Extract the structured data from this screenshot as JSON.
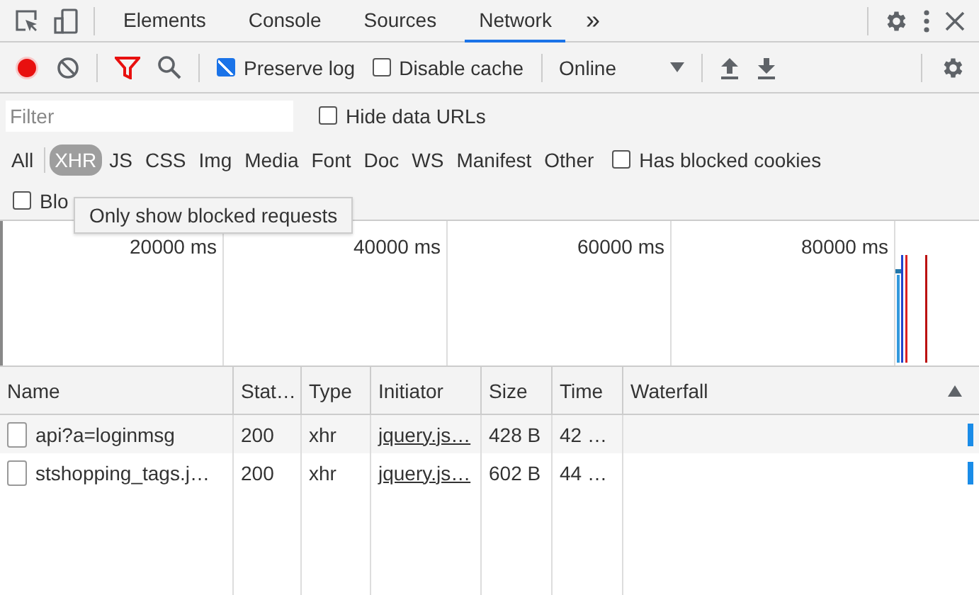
{
  "tabs": [
    {
      "label": "Elements",
      "selected": false
    },
    {
      "label": "Console",
      "selected": false
    },
    {
      "label": "Sources",
      "selected": false
    },
    {
      "label": "Network",
      "selected": true
    }
  ],
  "more_tabs": "»",
  "toolbar": {
    "recording": true,
    "preserve_log": {
      "label": "Preserve log",
      "checked": true
    },
    "disable_cache": {
      "label": "Disable cache",
      "checked": false
    },
    "throttling": "Online"
  },
  "filter": {
    "placeholder": "Filter",
    "hide_data_urls": {
      "label": "Hide data URLs",
      "checked": false
    }
  },
  "types": [
    {
      "label": "All",
      "selected": false
    },
    {
      "label": "XHR",
      "selected": true
    },
    {
      "label": "JS",
      "selected": false
    },
    {
      "label": "CSS",
      "selected": false
    },
    {
      "label": "Img",
      "selected": false
    },
    {
      "label": "Media",
      "selected": false
    },
    {
      "label": "Font",
      "selected": false
    },
    {
      "label": "Doc",
      "selected": false
    },
    {
      "label": "WS",
      "selected": false
    },
    {
      "label": "Manifest",
      "selected": false
    },
    {
      "label": "Other",
      "selected": false
    }
  ],
  "has_blocked_cookies": {
    "label": "Has blocked cookies",
    "checked": false
  },
  "blocked_requests": {
    "label": "Blo",
    "checked": false
  },
  "tooltip": "Only show blocked requests",
  "overview": {
    "ticks": [
      "20000 ms",
      "40000 ms",
      "60000 ms",
      "80000 ms"
    ]
  },
  "table": {
    "columns": [
      "Name",
      "Stat…",
      "Type",
      "Initiator",
      "Size",
      "Time",
      "Waterfall"
    ],
    "rows": [
      {
        "name": "api?a=loginmsg",
        "status": "200",
        "type": "xhr",
        "initiator": "jquery.js…",
        "size": "428 B",
        "time": "42 …"
      },
      {
        "name": "stshopping_tags.j…",
        "status": "200",
        "type": "xhr",
        "initiator": "jquery.js…",
        "size": "602 B",
        "time": "44 …"
      }
    ]
  }
}
